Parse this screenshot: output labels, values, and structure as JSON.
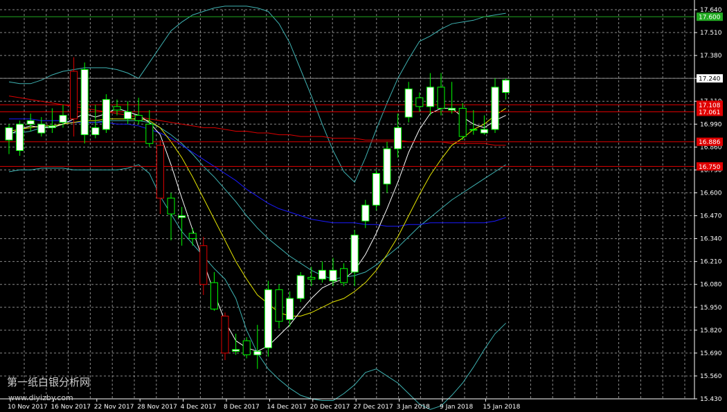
{
  "chart_data": {
    "type": "candlestick",
    "y_ticks": [
      "17.640",
      "17.510",
      "17.380",
      "17.240",
      "17.110",
      "16.990",
      "16.860",
      "16.730",
      "16.600",
      "16.470",
      "16.340",
      "16.210",
      "16.080",
      "15.950",
      "15.820",
      "15.690",
      "15.560",
      "15.430"
    ],
    "x_ticks": [
      "10 Nov 2017",
      "16 Nov 2017",
      "22 Nov 2017",
      "28 Nov 2017",
      "4 Dec 2017",
      "8 Dec 2017",
      "14 Dec 2017",
      "20 Dec 2017",
      "27 Dec 2017",
      "3 Jan 2018",
      "9 Jan 2018",
      "15 Jan 2018"
    ],
    "ylim": [
      15.43,
      17.64
    ],
    "grid": true,
    "candles": [
      [
        16.9,
        16.97,
        16.82,
        16.99
      ],
      [
        16.84,
        16.99,
        16.81,
        17.01
      ],
      [
        16.99,
        17.01,
        16.95,
        17.05
      ],
      [
        16.94,
        16.99,
        16.92,
        17.03
      ],
      [
        16.97,
        16.98,
        16.94,
        17.08
      ],
      [
        17.0,
        17.04,
        16.97,
        17.1
      ],
      [
        17.29,
        17.02,
        16.92,
        17.37
      ],
      [
        16.93,
        17.3,
        16.88,
        17.34
      ],
      [
        16.93,
        16.97,
        16.91,
        17.1
      ],
      [
        16.96,
        17.13,
        16.94,
        17.16
      ],
      [
        17.09,
        17.07,
        17.04,
        17.13
      ],
      [
        17.02,
        17.06,
        16.99,
        17.12
      ],
      [
        17.04,
        17.01,
        16.99,
        17.14
      ],
      [
        16.99,
        16.88,
        16.86,
        17.07
      ],
      [
        16.87,
        16.57,
        16.48,
        16.9
      ],
      [
        16.57,
        16.48,
        16.33,
        16.6
      ],
      [
        16.46,
        16.47,
        16.3,
        16.52
      ],
      [
        16.37,
        16.34,
        16.3,
        16.4
      ],
      [
        16.3,
        16.08,
        16.02,
        16.35
      ],
      [
        16.09,
        15.94,
        15.93,
        16.15
      ],
      [
        15.9,
        15.69,
        15.65,
        15.92
      ],
      [
        15.7,
        15.71,
        15.68,
        15.8
      ],
      [
        15.76,
        15.68,
        15.66,
        15.78
      ],
      [
        15.68,
        15.7,
        15.6,
        15.85
      ],
      [
        15.72,
        16.05,
        15.67,
        16.1
      ],
      [
        16.05,
        15.87,
        15.83,
        16.08
      ],
      [
        15.88,
        16.0,
        15.84,
        16.04
      ],
      [
        16.0,
        16.13,
        15.98,
        16.15
      ],
      [
        16.12,
        16.11,
        16.07,
        16.18
      ],
      [
        16.11,
        16.16,
        16.09,
        16.21
      ],
      [
        16.1,
        16.16,
        16.07,
        16.23
      ],
      [
        16.17,
        16.09,
        16.07,
        16.2
      ],
      [
        16.15,
        16.36,
        16.07,
        16.39
      ],
      [
        16.44,
        16.53,
        16.4,
        16.56
      ],
      [
        16.53,
        16.71,
        16.5,
        16.73
      ],
      [
        16.65,
        16.85,
        16.6,
        16.89
      ],
      [
        16.85,
        16.97,
        16.8,
        17.05
      ],
      [
        17.03,
        17.19,
        17.0,
        17.23
      ],
      [
        17.14,
        17.09,
        17.06,
        17.17
      ],
      [
        17.09,
        17.2,
        17.04,
        17.28
      ],
      [
        17.2,
        17.08,
        17.04,
        17.28
      ],
      [
        17.07,
        17.08,
        17.05,
        17.23
      ],
      [
        17.08,
        16.92,
        16.9,
        17.11
      ],
      [
        16.96,
        16.96,
        16.93,
        17.07
      ],
      [
        16.94,
        16.96,
        16.93,
        17.04
      ],
      [
        16.96,
        17.2,
        16.94,
        17.25
      ],
      [
        17.17,
        17.24,
        17.13,
        17.25
      ]
    ],
    "ma_white": [
      16.93,
      16.96,
      16.98,
      16.97,
      16.97,
      16.99,
      17.02,
      17.05,
      17.03,
      17.05,
      17.08,
      17.06,
      17.04,
      17.0,
      16.93,
      16.76,
      16.57,
      16.39,
      16.21,
      16.03,
      15.87,
      15.76,
      15.72,
      15.7,
      15.73,
      15.79,
      15.85,
      15.93,
      16.0,
      16.06,
      16.09,
      16.11,
      16.16,
      16.25,
      16.37,
      16.51,
      16.66,
      16.83,
      16.96,
      17.05,
      17.08,
      17.08,
      17.03,
      16.99,
      16.97,
      17.01,
      17.04
    ],
    "ma_yellow": [
      16.95,
      16.96,
      16.97,
      16.98,
      16.98,
      16.99,
      17.0,
      17.01,
      17.01,
      17.02,
      17.02,
      17.02,
      17.02,
      17.01,
      16.97,
      16.89,
      16.8,
      16.69,
      16.57,
      16.45,
      16.33,
      16.21,
      16.11,
      16.02,
      15.97,
      15.92,
      15.9,
      15.9,
      15.92,
      15.95,
      15.98,
      16.0,
      16.04,
      16.09,
      16.16,
      16.25,
      16.35,
      16.47,
      16.59,
      16.7,
      16.79,
      16.87,
      16.91,
      16.96,
      16.99,
      17.04,
      17.08
    ],
    "ma_blue": [
      17.02,
      17.02,
      17.02,
      17.01,
      17.01,
      17.01,
      17.0,
      17.0,
      17.0,
      17.0,
      16.99,
      16.99,
      16.98,
      16.96,
      16.94,
      16.91,
      16.87,
      16.83,
      16.79,
      16.75,
      16.71,
      16.67,
      16.62,
      16.58,
      16.54,
      16.51,
      16.49,
      16.47,
      16.45,
      16.44,
      16.43,
      16.43,
      16.43,
      16.42,
      16.42,
      16.41,
      16.41,
      16.42,
      16.42,
      16.43,
      16.43,
      16.43,
      16.43,
      16.43,
      16.43,
      16.44,
      16.46
    ],
    "ma_red": [
      17.15,
      17.14,
      17.13,
      17.12,
      17.11,
      17.1,
      17.09,
      17.08,
      17.07,
      17.06,
      17.05,
      17.04,
      17.03,
      17.02,
      17.01,
      17.0,
      16.99,
      16.98,
      16.97,
      16.97,
      16.96,
      16.95,
      16.95,
      16.94,
      16.94,
      16.93,
      16.93,
      16.92,
      16.92,
      16.92,
      16.91,
      16.91,
      16.91,
      16.9,
      16.9,
      16.9,
      16.9,
      16.89,
      16.89,
      16.89,
      16.89,
      16.88,
      16.88,
      16.88,
      16.88,
      16.87,
      16.87
    ],
    "bb_upper": [
      17.23,
      17.22,
      17.22,
      17.24,
      17.27,
      17.29,
      17.3,
      17.31,
      17.31,
      17.31,
      17.3,
      17.28,
      17.25,
      17.34,
      17.43,
      17.52,
      17.57,
      17.61,
      17.63,
      17.65,
      17.66,
      17.66,
      17.66,
      17.65,
      17.63,
      17.56,
      17.45,
      17.3,
      17.15,
      16.99,
      16.84,
      16.72,
      16.66,
      16.8,
      16.96,
      17.11,
      17.25,
      17.36,
      17.46,
      17.49,
      17.53,
      17.56,
      17.57,
      17.58,
      17.6,
      17.61,
      17.62
    ],
    "bb_lower": [
      16.72,
      16.73,
      16.73,
      16.74,
      16.74,
      16.74,
      16.73,
      16.73,
      16.73,
      16.73,
      16.73,
      16.74,
      16.76,
      16.71,
      16.58,
      16.48,
      16.38,
      16.31,
      16.24,
      16.17,
      16.11,
      16.0,
      15.82,
      15.69,
      15.6,
      15.54,
      15.49,
      15.45,
      15.43,
      15.42,
      15.42,
      15.46,
      15.51,
      15.58,
      15.6,
      15.56,
      15.52,
      15.46,
      15.4,
      15.37,
      15.39,
      15.45,
      15.52,
      15.61,
      15.71,
      15.8,
      15.86
    ],
    "bb_mid": [
      16.94,
      16.94,
      16.95,
      16.97,
      16.98,
      16.99,
      17.0,
      17.0,
      17.0,
      17.01,
      17.01,
      17.01,
      17.01,
      17.0,
      16.97,
      16.93,
      16.88,
      16.82,
      16.75,
      16.69,
      16.62,
      16.55,
      16.47,
      16.4,
      16.34,
      16.29,
      16.24,
      16.2,
      16.16,
      16.13,
      16.11,
      16.12,
      16.13,
      16.15,
      16.19,
      16.24,
      16.29,
      16.35,
      16.41,
      16.46,
      16.51,
      16.56,
      16.6,
      16.64,
      16.68,
      16.72,
      16.76
    ],
    "h_lines": [
      {
        "price": 17.6,
        "color": "#22aa22",
        "label": "17.600"
      },
      {
        "price": 17.25,
        "color": "#8c8c8c",
        "label": "17.240"
      },
      {
        "price": 17.1,
        "color": "#e00000",
        "label": "17.108"
      },
      {
        "price": 17.06,
        "color": "#e00000",
        "label": "17.061"
      },
      {
        "price": 16.89,
        "color": "#e00000",
        "label": "16.886"
      },
      {
        "price": 16.75,
        "color": "#e00000",
        "label": "16.750"
      }
    ],
    "colors": {
      "background": "#000000",
      "grid": "#8a8a8a",
      "bull_fill": "#ffffff",
      "bull_stroke": "#00ff00",
      "bear_fill": "#000000",
      "bear_stroke": "#00ff00",
      "bear_red": "#e00000",
      "ma_white": "#ffffff",
      "ma_yellow": "#e6e600",
      "ma_blue": "#1a1aff",
      "ma_red": "#e00000",
      "bands": "#3fb3b3",
      "axis": "#ffffff"
    }
  },
  "watermark": {
    "line1": "第一纸白银分析网",
    "line2": "www.diyizby.com"
  }
}
